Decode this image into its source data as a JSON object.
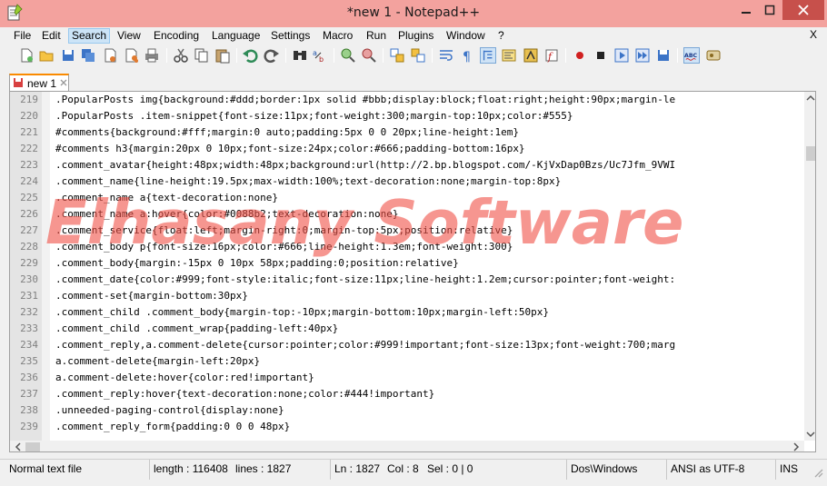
{
  "window": {
    "title": "*new  1 - Notepad++"
  },
  "menu": {
    "items": [
      "File",
      "Edit",
      "Search",
      "View",
      "Encoding",
      "Language",
      "Settings",
      "Macro",
      "Run",
      "Plugins",
      "Window",
      "?"
    ],
    "active": "Search",
    "close_label": "X"
  },
  "toolbar": {
    "icons": [
      "new-file-icon",
      "open-file-icon",
      "save-icon",
      "save-all-icon",
      "close-icon",
      "close-all-icon",
      "print-icon",
      "cut-icon",
      "copy-icon",
      "paste-icon",
      "undo-icon",
      "redo-icon",
      "find-icon",
      "replace-icon",
      "zoom-in-icon",
      "zoom-out-icon",
      "sync-vertical-icon",
      "sync-horizontal-icon",
      "word-wrap-icon",
      "show-all-chars-icon",
      "indent-guide-icon",
      "doc-map-icon",
      "function-list-icon",
      "folder-workspace-icon",
      "record-macro-icon",
      "stop-macro-icon",
      "play-macro-icon",
      "run-macro-multiple-icon",
      "save-macro-icon",
      "spell-check-icon",
      "hex-icon"
    ]
  },
  "tab": {
    "label": "new  1"
  },
  "editor": {
    "lines": [
      {
        "num": "219",
        "text": ".PopularPosts img{background:#ddd;border:1px solid #bbb;display:block;float:right;height:90px;margin-le"
      },
      {
        "num": "220",
        "text": ".PopularPosts .item-snippet{font-size:11px;font-weight:300;margin-top:10px;color:#555}"
      },
      {
        "num": "221",
        "text": "#comments{background:#fff;margin:0 auto;padding:5px 0 0 20px;line-height:1em}"
      },
      {
        "num": "222",
        "text": "#comments h3{margin:20px 0 10px;font-size:24px;color:#666;padding-bottom:16px}"
      },
      {
        "num": "223",
        "text": ".comment_avatar{height:48px;width:48px;background:url(http://2.bp.blogspot.com/-KjVxDap0Bzs/Uc7Jfm_9VWI"
      },
      {
        "num": "224",
        "text": ".comment_name{line-height:19.5px;max-width:100%;text-decoration:none;margin-top:8px}"
      },
      {
        "num": "225",
        "text": ".comment_name a{text-decoration:none}"
      },
      {
        "num": "226",
        "text": ".comment_name a:hover{color:#0088b2;text-decoration:none}"
      },
      {
        "num": "227",
        "text": ".comment_service{float:left;margin-right:0;margin-top:5px;position:relative}"
      },
      {
        "num": "228",
        "text": ".comment_body p{font-size:16px;color:#666;line-height:1.3em;font-weight:300}"
      },
      {
        "num": "229",
        "text": ".comment_body{margin:-15px 0 10px 58px;padding:0;position:relative}"
      },
      {
        "num": "230",
        "text": ".comment_date{color:#999;font-style:italic;font-size:11px;line-height:1.2em;cursor:pointer;font-weight:"
      },
      {
        "num": "231",
        "text": ".comment-set{margin-bottom:30px}"
      },
      {
        "num": "232",
        "text": ".comment_child .comment_body{margin-top:-10px;margin-bottom:10px;margin-left:50px}"
      },
      {
        "num": "233",
        "text": ".comment_child .comment_wrap{padding-left:40px}"
      },
      {
        "num": "234",
        "text": ".comment_reply,a.comment-delete{cursor:pointer;color:#999!important;font-size:13px;font-weight:700;marg"
      },
      {
        "num": "235",
        "text": "a.comment-delete{margin-left:20px}"
      },
      {
        "num": "236",
        "text": "a.comment-delete:hover{color:red!important}"
      },
      {
        "num": "237",
        "text": ".comment_reply:hover{text-decoration:none;color:#444!important}"
      },
      {
        "num": "238",
        "text": ".unneeded-paging-control{display:none}"
      },
      {
        "num": "239",
        "text": ".comment_reply_form{padding:0 0 0 48px}"
      }
    ],
    "watermark": "Elhasany Software"
  },
  "status": {
    "type": "Normal text file",
    "length": "length : 116408",
    "lines": "lines : 1827",
    "position": "Ln : 1827",
    "col": "Col : 8",
    "sel": "Sel : 0 | 0",
    "eol": "Dos\\Windows",
    "encoding": "ANSI as UTF-8",
    "mode": "INS"
  },
  "colors": {
    "titlebar": "#f3a29e",
    "close_button": "#c7504b",
    "tab_accent": "#fa8a00",
    "watermark": "#f05046"
  }
}
